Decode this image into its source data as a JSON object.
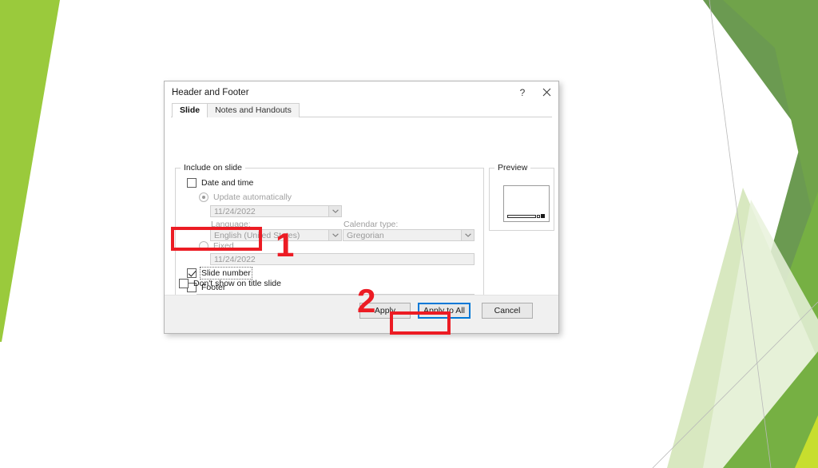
{
  "slide": {
    "background_color": "#ffffff",
    "accent_colors": {
      "bright_green": "#9ACA3C",
      "mid_green": "#70A34A",
      "dark_green": "#5E9142",
      "leaf_green": "#76B043",
      "pale_green": "#D8E8C0",
      "very_pale_green": "#E9F2DC",
      "lime": "#C7DE2E",
      "hairline": "#b9b9b9"
    }
  },
  "dialog": {
    "title": "Header and Footer",
    "help_button": "?",
    "close_button": "×",
    "tabs": [
      {
        "label": "Slide",
        "active": true
      },
      {
        "label": "Notes and Handouts",
        "active": false
      }
    ],
    "include_group": {
      "legend": "Include on slide",
      "date_and_time": {
        "label": "Date and time",
        "checked": false
      },
      "update_automatically": {
        "label": "Update automatically",
        "selected": true,
        "disabled": true
      },
      "date_combo": {
        "value": "11/24/2022"
      },
      "language": {
        "label": "Language:",
        "value": "English (United States)"
      },
      "calendar_type": {
        "label": "Calendar type:",
        "value": "Gregorian"
      },
      "fixed": {
        "label": "Fixed",
        "selected": false,
        "disabled": true
      },
      "fixed_value": "11/24/2022",
      "slide_number": {
        "label": "Slide number",
        "checked": true,
        "focused": true
      },
      "footer": {
        "label": "Footer",
        "checked": false
      },
      "footer_value": ""
    },
    "dont_show_on_title_slide": {
      "label": "Don't show on title slide",
      "checked": false
    },
    "preview": {
      "legend": "Preview"
    },
    "buttons": {
      "apply": "Apply",
      "apply_to_all": "Apply to All",
      "cancel": "Cancel",
      "default_button": "Apply to All"
    }
  },
  "annotations": {
    "color": "#ec1c24",
    "markers": [
      {
        "number": "1",
        "target": "slide-number-checkbox"
      },
      {
        "number": "2",
        "target": "apply-button"
      }
    ]
  }
}
